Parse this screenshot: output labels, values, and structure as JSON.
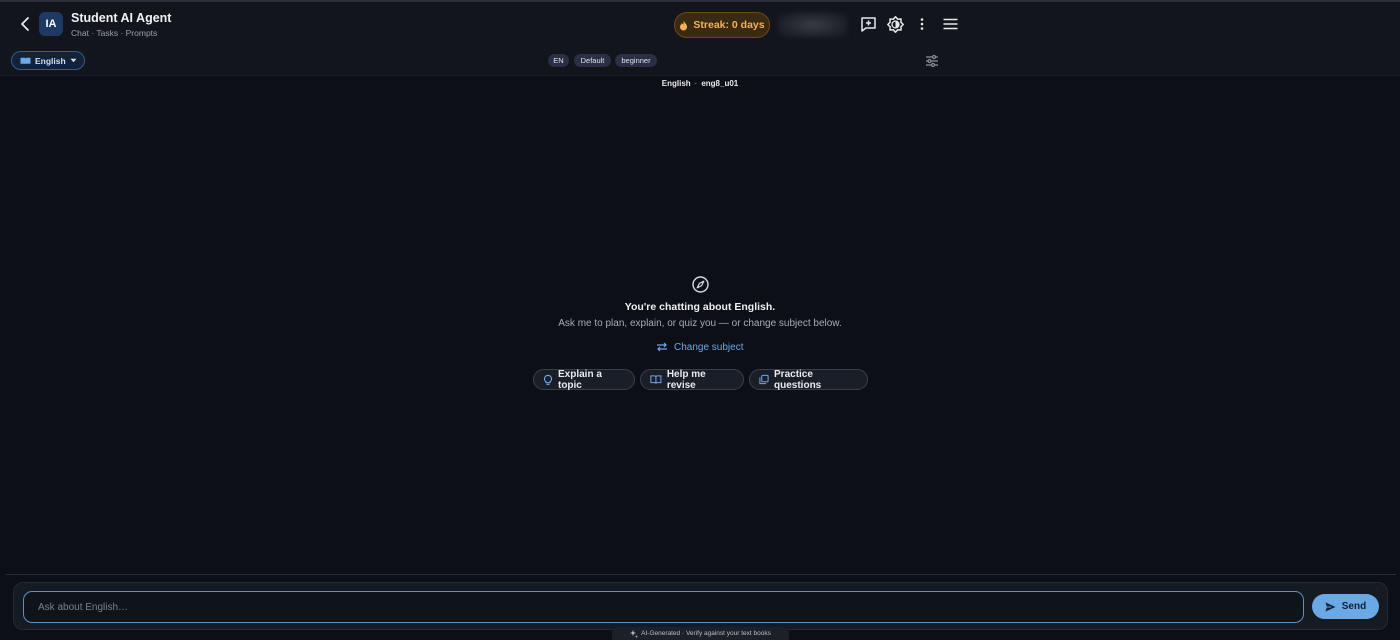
{
  "header": {
    "avatar_initials": "IA",
    "title": "Student AI Agent",
    "subtitle": "Chat · Tasks · Prompts",
    "streak_label": "Streak: 0 days",
    "streak_color": "#f3b25a"
  },
  "toolbar": {
    "language": "English",
    "chips": [
      "EN",
      "Default",
      "beginner"
    ]
  },
  "context": {
    "subject": "English",
    "unit": "eng8_u01"
  },
  "empty_state": {
    "headline": "You're chatting about English.",
    "description": "Ask me to plan, explain, or quiz you — or change subject below.",
    "change_subject": "Change subject",
    "suggestions": [
      "Explain a topic",
      "Help me revise",
      "Practice questions"
    ]
  },
  "composer": {
    "placeholder": "Ask about English…",
    "send_label": "Send"
  },
  "footer": {
    "note": "AI-Generated · Verify against your text books"
  },
  "colors": {
    "background": "#0c0f15",
    "accent": "#6aa8e6",
    "link": "#6fa8e8"
  }
}
